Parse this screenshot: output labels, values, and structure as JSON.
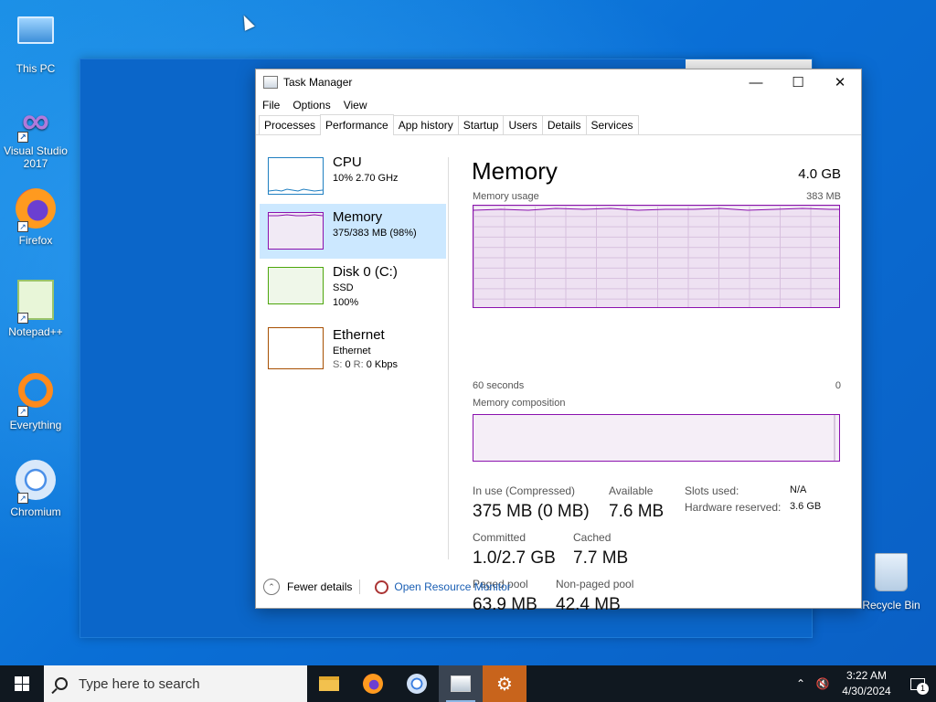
{
  "desktop": {
    "icons": [
      {
        "label": "This PC"
      },
      {
        "label": "Visual Studio 2017"
      },
      {
        "label": "Firefox"
      },
      {
        "label": "Notepad++"
      },
      {
        "label": "Everything"
      },
      {
        "label": "Chromium"
      },
      {
        "label": "Recycle Bin"
      }
    ]
  },
  "task_manager": {
    "title": "Task Manager",
    "menu": [
      "File",
      "Options",
      "View"
    ],
    "tabs": [
      "Processes",
      "Performance",
      "App history",
      "Startup",
      "Users",
      "Details",
      "Services"
    ],
    "active_tab": "Performance",
    "resources": [
      {
        "name": "CPU",
        "line1": "10%  2.70 GHz",
        "line2": "",
        "color": "#1f7fc1"
      },
      {
        "name": "Memory",
        "line1": "375/383 MB (98%)",
        "line2": "",
        "color": "#8b12ae"
      },
      {
        "name": "Disk 0 (C:)",
        "line1": "SSD",
        "line2": "100%",
        "color": "#4da60c"
      },
      {
        "name": "Ethernet",
        "line1": "Ethernet",
        "line2_label": "S:",
        "line2_s": "0",
        "line2_rlabel": "R:",
        "line2_r": "0 Kbps",
        "color": "#a74f01"
      }
    ],
    "memory": {
      "title": "Memory",
      "total": "4.0 GB",
      "usage_label": "Memory usage",
      "usage_max": "383 MB",
      "time_left": "60 seconds",
      "time_right": "0",
      "composition_label": "Memory composition",
      "stats": {
        "in_use_label": "In use (Compressed)",
        "in_use": "375 MB (0 MB)",
        "available_label": "Available",
        "available": "7.6 MB",
        "committed_label": "Committed",
        "committed": "1.0/2.7 GB",
        "cached_label": "Cached",
        "cached": "7.7 MB",
        "paged_label": "Paged pool",
        "paged": "63.9 MB",
        "nonpaged_label": "Non-paged pool",
        "nonpaged": "42.4 MB",
        "slots_label": "Slots used:",
        "slots": "N/A",
        "hw_label": "Hardware reserved:",
        "hw": "3.6 GB"
      }
    },
    "footer": {
      "fewer_details": "Fewer details",
      "resource_monitor": "Open Resource Monitor"
    }
  },
  "taskbar": {
    "search_placeholder": "Type here to search",
    "time": "3:22 AM",
    "date": "4/30/2024",
    "notification_count": "1",
    "apps": [
      "file-explorer",
      "firefox",
      "chromium",
      "task-manager",
      "settings"
    ]
  }
}
